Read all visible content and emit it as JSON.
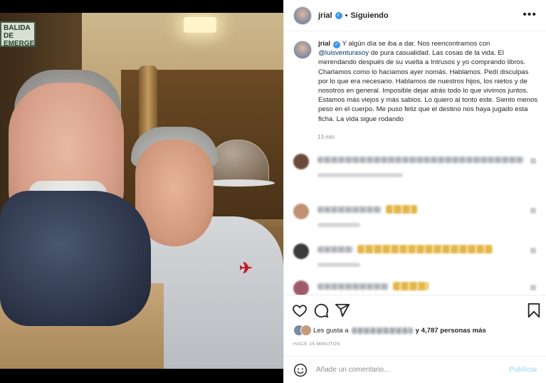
{
  "post": {
    "username": "jrial",
    "follow_state": "Siguiendo",
    "more_menu": "•••",
    "caption_user": "jrial",
    "caption_before": " Y algún día se iba a dar. Nos reencontramos con ",
    "caption_mention": "@luisventurasoy",
    "caption_after": " de pura casualidad. Las cosas de la vida. El merendando después de su vuelta a Intrusos y yo comprando libros. Charlamos como lo haciamos ayer nomás. Hablamos. Pedí disculpas por lo que era necesario. Hablamos de nuestros hijos, los nietos y de nosotros en general. Imposible dejar atrás todo lo que vivimos juntos. Estamos más viejos y más sabios. Lo quiero al tonto este. Siento menos peso en el cuerpo. Me puso feliz que el destino nos haya jugado esta ficha. La vida sigue rodando",
    "caption_time": "13 min"
  },
  "photo": {
    "sign_text": "BALIDA DE EMERGENCIA"
  },
  "likes": {
    "prefix": "Les gusta a",
    "suffix": "y 4,787 personas más"
  },
  "time_ago": "HACE 25 MINUTOS",
  "composer": {
    "placeholder": "Añade un comentario...",
    "publish_label": "Publicar"
  },
  "colors": {
    "link": "#00376b",
    "verified": "#3897f0",
    "publish_disabled": "#b2dffc",
    "muted": "#8e8e8e"
  },
  "icons": [
    "verified-badge-icon",
    "heart-icon",
    "comment-icon",
    "share-icon",
    "bookmark-icon",
    "emoji-icon"
  ]
}
